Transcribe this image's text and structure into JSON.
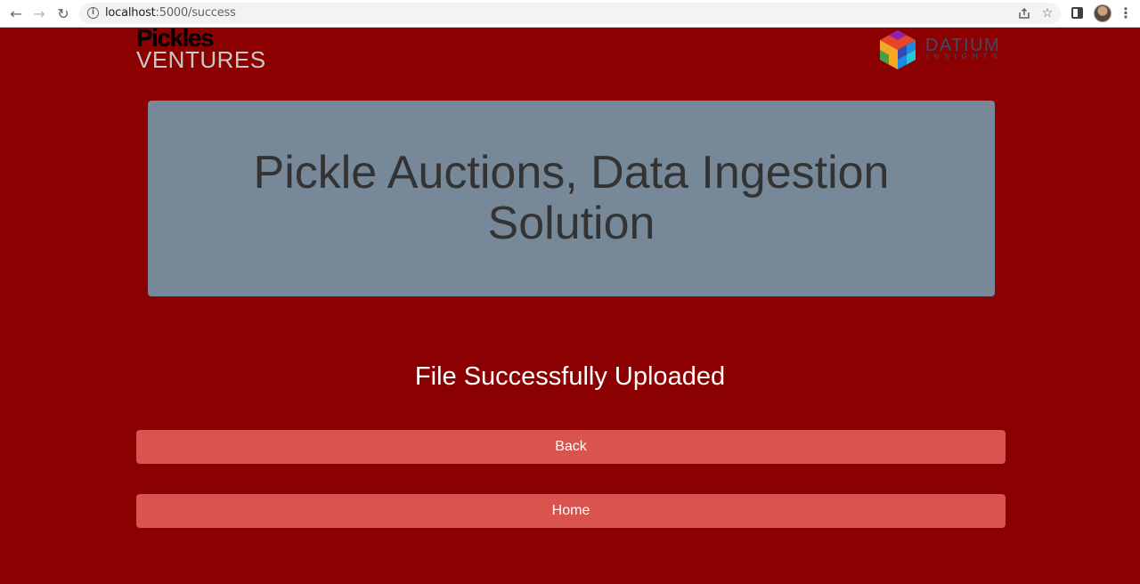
{
  "browser": {
    "url_host": "localhost",
    "url_path": ":5000/success",
    "icons": [
      "back-arrow-icon",
      "forward-arrow-icon",
      "reload-icon",
      "info-icon",
      "share-icon",
      "star-icon",
      "side-panel-icon",
      "profile-avatar",
      "kebab-menu-icon"
    ]
  },
  "logos": {
    "pickles_top": "Pickles",
    "pickles_bottom": "VENTURES",
    "datium_top": "DATIUM",
    "datium_bottom": "INSIGHTS"
  },
  "banner": {
    "title": "Pickle Auctions, Data Ingestion Solution"
  },
  "status": {
    "message": "File Successfully Uploaded"
  },
  "buttons": {
    "back_label": "Back",
    "home_label": "Home"
  },
  "colors": {
    "page_background": "#8b0000",
    "banner_background": "#778899",
    "banner_text": "#333333",
    "button_background": "#d9534f",
    "button_text": "#ffffff"
  }
}
